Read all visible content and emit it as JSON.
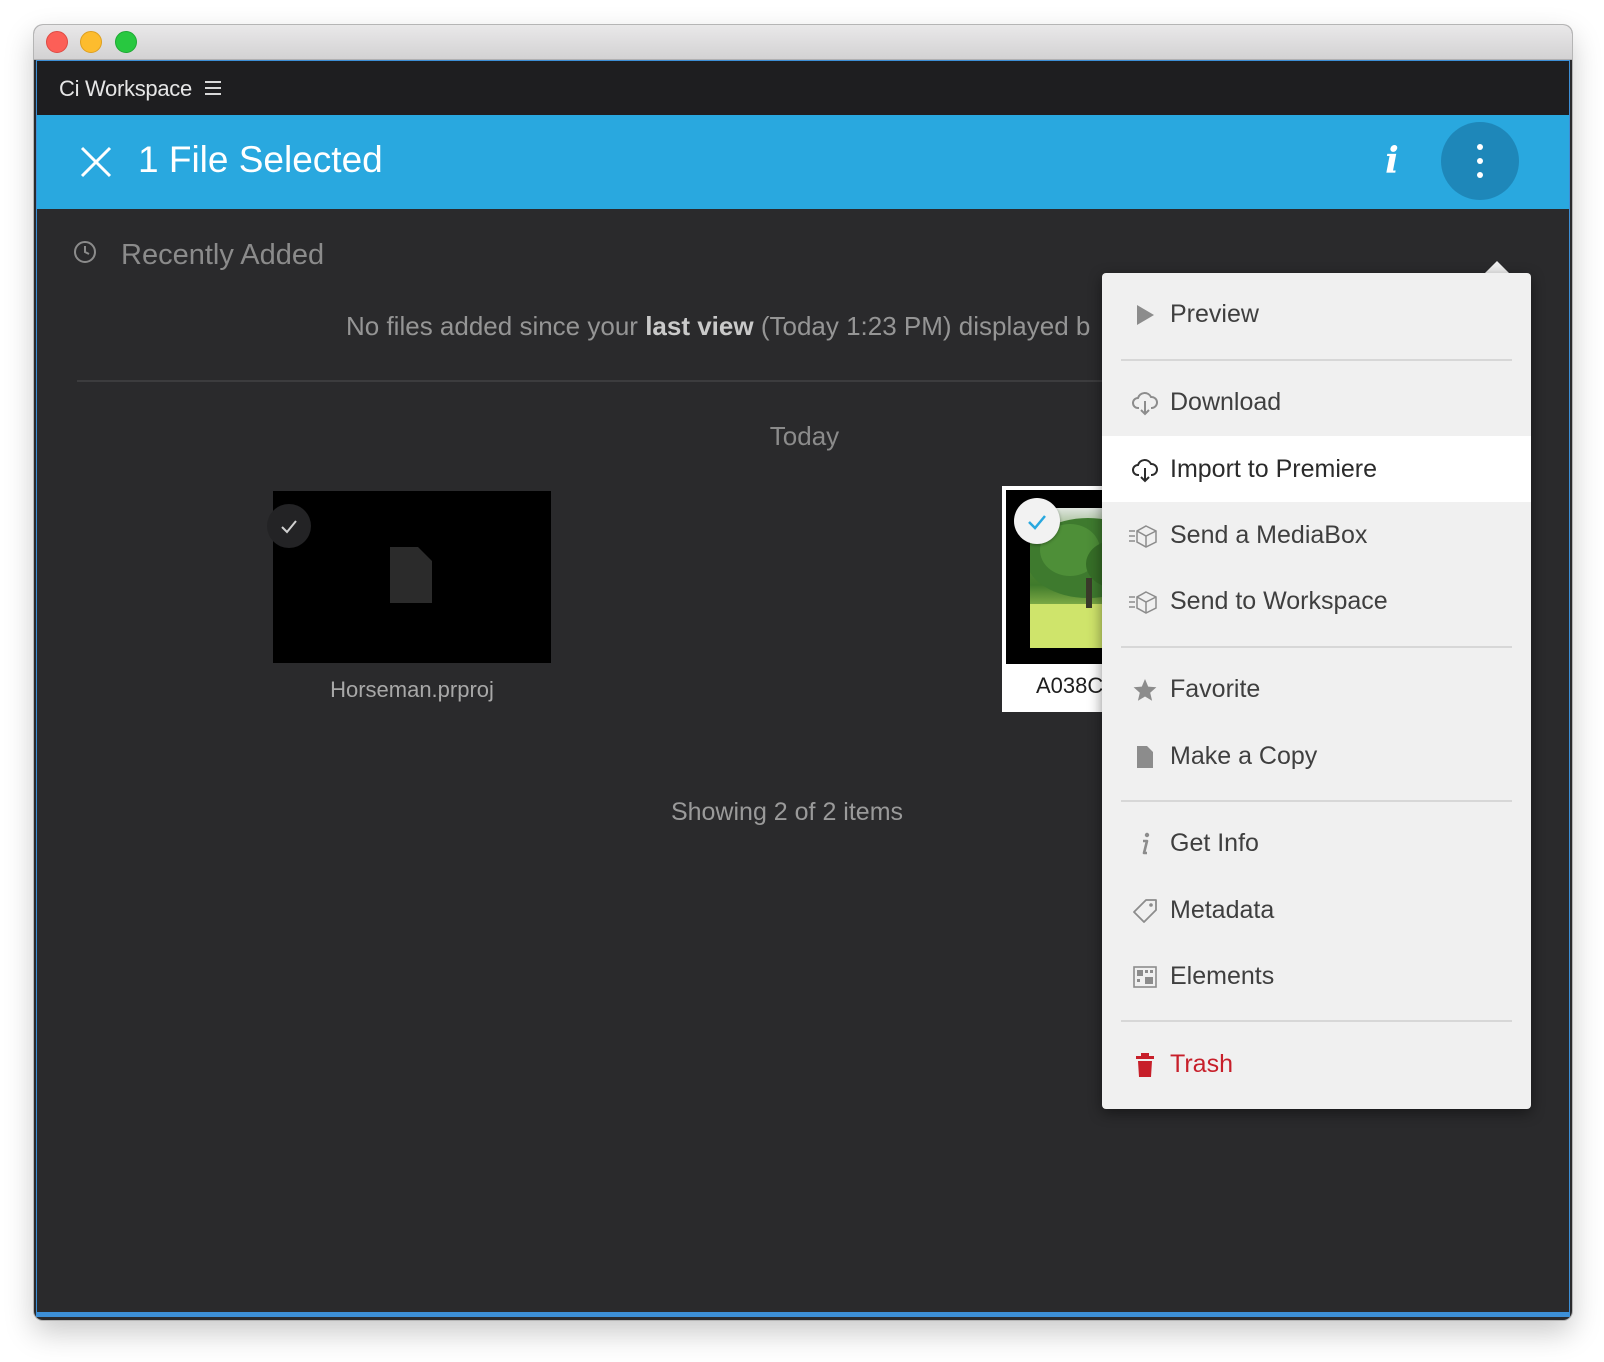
{
  "app": {
    "title": "Ci Workspace"
  },
  "selection_bar": {
    "title": "1 File Selected",
    "info_glyph": "i",
    "background_color": "#29a8df"
  },
  "section": {
    "title": "Recently Added",
    "message_prefix": "No files added since your",
    "message_bold": "last view",
    "message_suffix": "(Today   1:23 PM) displayed b",
    "group_label": "Today",
    "showing_text": "Showing 2 of 2 items"
  },
  "files": [
    {
      "name": "Horseman.prproj",
      "selected": false,
      "icon": "file-icon"
    },
    {
      "name": "A038C",
      "selected": true,
      "icon": "video-thumbnail"
    }
  ],
  "context_menu": {
    "items": [
      {
        "label": "Preview",
        "icon": "play-icon"
      },
      {
        "label": "Download",
        "icon": "cloud-download-icon"
      },
      {
        "label": "Import to Premiere",
        "icon": "cloud-download-icon",
        "highlighted": true
      },
      {
        "label": "Send a MediaBox",
        "icon": "mediabox-icon"
      },
      {
        "label": "Send to Workspace",
        "icon": "mediabox-icon"
      },
      {
        "label": "Favorite",
        "icon": "star-icon"
      },
      {
        "label": "Make a Copy",
        "icon": "document-icon"
      },
      {
        "label": "Get Info",
        "icon": "info-icon"
      },
      {
        "label": "Metadata",
        "icon": "tag-icon"
      },
      {
        "label": "Elements",
        "icon": "elements-grid-icon"
      },
      {
        "label": "Trash",
        "icon": "trash-icon",
        "color": "#c71f2a"
      }
    ]
  }
}
